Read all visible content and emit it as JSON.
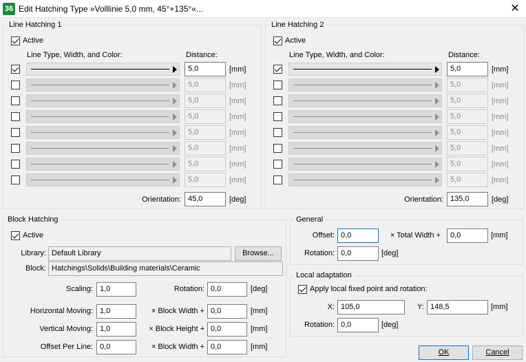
{
  "window": {
    "title": "Edit Hatching Type »Volllinie 5,0 mm, 45°+135°«...",
    "app_icon": "36",
    "close_glyph": "✕"
  },
  "line_hatching_1": {
    "title": "Line Hatching 1",
    "active_label": "Active",
    "active": true,
    "col_line": "Line Type, Width, and Color:",
    "col_distance": "Distance:",
    "rows": [
      {
        "checked": true,
        "distance": "5,0",
        "unit": "[mm]"
      },
      {
        "checked": false,
        "distance": "5,0",
        "unit": "[mm]"
      },
      {
        "checked": false,
        "distance": "5,0",
        "unit": "[mm]"
      },
      {
        "checked": false,
        "distance": "5,0",
        "unit": "[mm]"
      },
      {
        "checked": false,
        "distance": "5,0",
        "unit": "[mm]"
      },
      {
        "checked": false,
        "distance": "5,0",
        "unit": "[mm]"
      },
      {
        "checked": false,
        "distance": "5,0",
        "unit": "[mm]"
      },
      {
        "checked": false,
        "distance": "5,0",
        "unit": "[mm]"
      }
    ],
    "orientation_label": "Orientation:",
    "orientation": "45,0",
    "orientation_unit": "[deg]"
  },
  "line_hatching_2": {
    "title": "Line Hatching 2",
    "active_label": "Active",
    "active": true,
    "col_line": "Line Type, Width, and Color:",
    "col_distance": "Distance:",
    "rows": [
      {
        "checked": true,
        "distance": "5,0",
        "unit": "[mm]"
      },
      {
        "checked": false,
        "distance": "5,0",
        "unit": "[mm]"
      },
      {
        "checked": false,
        "distance": "5,0",
        "unit": "[mm]"
      },
      {
        "checked": false,
        "distance": "5,0",
        "unit": "[mm]"
      },
      {
        "checked": false,
        "distance": "5,0",
        "unit": "[mm]"
      },
      {
        "checked": false,
        "distance": "5,0",
        "unit": "[mm]"
      },
      {
        "checked": false,
        "distance": "5,0",
        "unit": "[mm]"
      },
      {
        "checked": false,
        "distance": "5,0",
        "unit": "[mm]"
      }
    ],
    "orientation_label": "Orientation:",
    "orientation": "135,0",
    "orientation_unit": "[deg]"
  },
  "block_hatching": {
    "title": "Block Hatching",
    "active_label": "Active",
    "active": true,
    "library_label": "Library:",
    "library": "Default Library",
    "browse_label": "Browse...",
    "block_label": "Block:",
    "block": "Hatchings\\Solids\\Building materials\\Ceramic",
    "scaling_label": "Scaling:",
    "scaling": "1,0",
    "rotation_label": "Rotation:",
    "rotation": "0,0",
    "rotation_unit": "[deg]",
    "h_moving_label": "Horizontal Moving:",
    "h_moving": "1,0",
    "h_moving_op": "× Block Width +",
    "h_moving_add": "0,0",
    "v_moving_label": "Vertical Moving:",
    "v_moving": "1,0",
    "v_moving_op": "× Block Height +",
    "v_moving_add": "0,0",
    "offset_line_label": "Offset Per Line:",
    "offset_line": "0,0",
    "offset_line_op": "× Block Width +",
    "offset_line_add": "0,0",
    "unit_mm": "[mm]"
  },
  "general": {
    "title": "General",
    "offset_label": "Offset:",
    "offset": "0,0",
    "offset_op": "× Total Width +",
    "offset_add": "0,0",
    "unit_mm": "[mm]",
    "rotation_label": "Rotation:",
    "rotation": "0,0",
    "rotation_unit": "[deg]"
  },
  "local_adaptation": {
    "title": "Local adaptation",
    "apply_label": "Apply local fixed point and rotation:",
    "apply": true,
    "x_label": "X:",
    "x": "105,0",
    "y_label": "Y:",
    "y": "148,5",
    "unit_mm": "[mm]",
    "rotation_label": "Rotation:",
    "rotation": "0,0",
    "rotation_unit": "[deg]"
  },
  "buttons": {
    "ok": "OK",
    "cancel": "Cancel"
  }
}
